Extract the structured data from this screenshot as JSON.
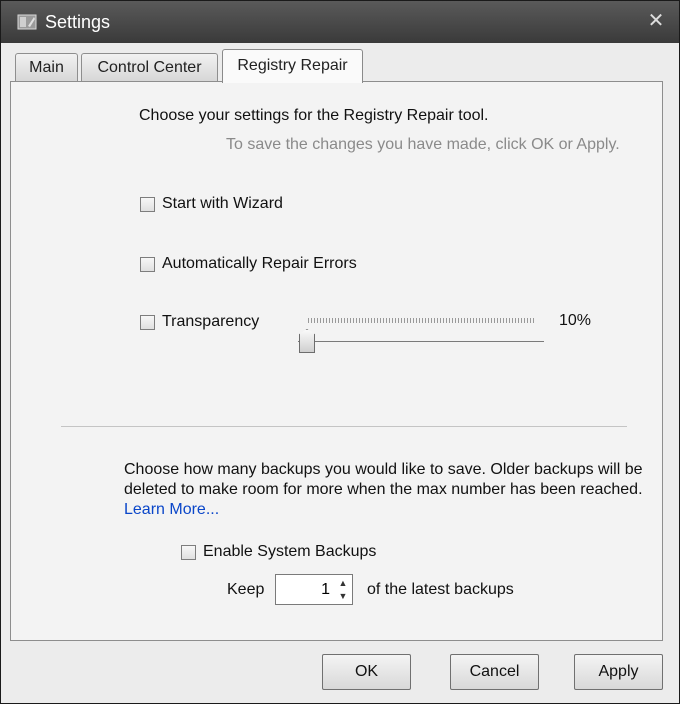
{
  "window": {
    "title": "Settings",
    "icon": "settings-app-icon",
    "close_glyph": "✕"
  },
  "tabs": [
    {
      "label": "Main",
      "active": false
    },
    {
      "label": "Control Center",
      "active": false
    },
    {
      "label": "Registry Repair",
      "active": true
    }
  ],
  "panel": {
    "heading": "Choose your settings for the Registry Repair tool.",
    "hint": "To save the changes you have made, click OK or Apply.",
    "options": {
      "wizard": {
        "label": "Start with Wizard",
        "checked": false
      },
      "auto_repair": {
        "label": "Automatically Repair Errors",
        "checked": false
      },
      "transparency": {
        "label": "Transparency",
        "checked": false,
        "value": 0.1,
        "value_label": "10%"
      }
    },
    "backups": {
      "description": "Choose how many backups you would like to save.  Older backups will be deleted to make room for more when the max number has been reached.",
      "learn_more": "Learn More...",
      "enable_label": "Enable System Backups",
      "enable_checked": false,
      "keep_label": "Keep",
      "keep_value": "1",
      "keep_suffix": "of the latest backups"
    }
  },
  "buttons": {
    "ok": "OK",
    "cancel": "Cancel",
    "apply": "Apply"
  },
  "colors": {
    "link": "#0a46c9",
    "titlebar": "#444444"
  }
}
